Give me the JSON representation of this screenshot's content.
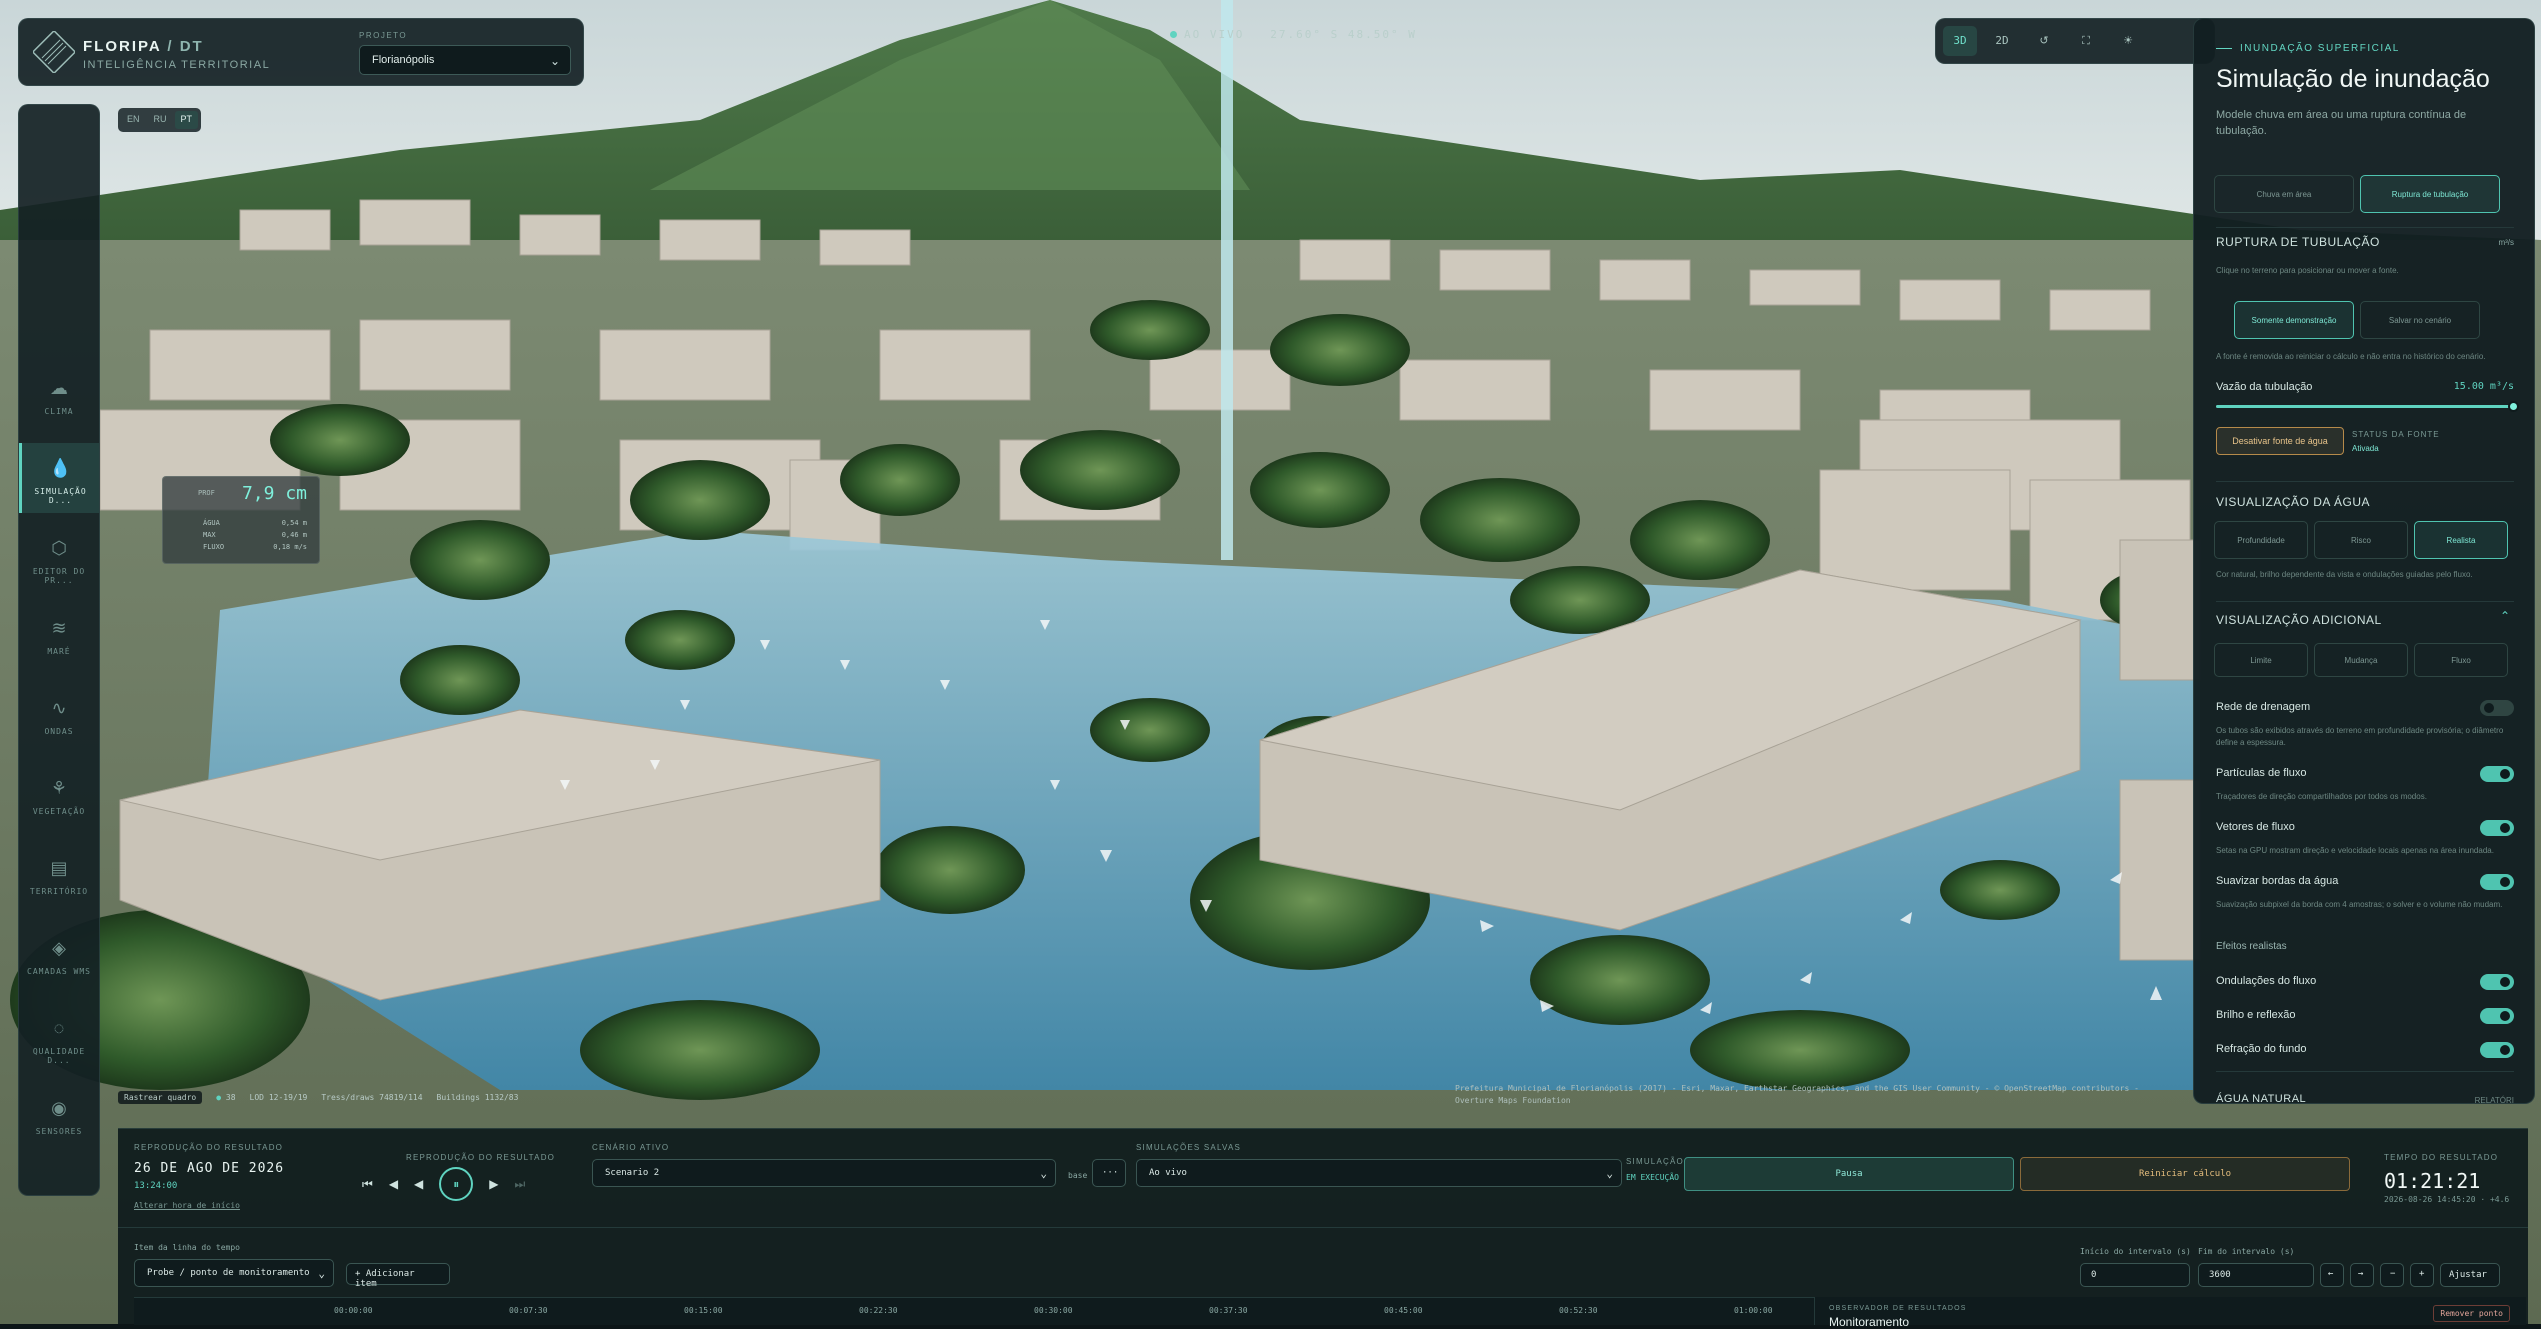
{
  "colors": {
    "accent": "#5fd3c0",
    "warning": "#e0b36a",
    "panel": "#14212a"
  },
  "header": {
    "brand": "FLORIPA",
    "brand_sep": "/",
    "brand_suffix": "DT",
    "subtitle": "INTELIGÊNCIA TERRITORIAL",
    "project_label": "PROJETO",
    "project_value": "Florianópolis"
  },
  "sidebar": {
    "items": [
      {
        "label": "CLIMA",
        "icon": "cloud-icon"
      },
      {
        "label": "SIMULAÇÃO D...",
        "icon": "water-drop-icon",
        "active": true
      },
      {
        "label": "EDITOR DO PR...",
        "icon": "cube-icon"
      },
      {
        "label": "MARÉ",
        "icon": "tide-icon"
      },
      {
        "label": "ONDAS",
        "icon": "wave-icon"
      },
      {
        "label": "VEGETAÇÃO",
        "icon": "plant-icon"
      },
      {
        "label": "TERRITÓRIO",
        "icon": "map-icon"
      },
      {
        "label": "CAMADAS WMS",
        "icon": "layers-icon"
      },
      {
        "label": "QUALIDADE D...",
        "icon": "droplet-quality-icon"
      },
      {
        "label": "SENSORES",
        "icon": "sensor-icon"
      }
    ]
  },
  "lang": [
    "EN",
    "RU",
    "PT"
  ],
  "live": {
    "text": "AO VIVO",
    "coords": "27.60° S 48.50° W"
  },
  "viewtools": {
    "btn_3d": "3D",
    "btn_2d": "2D"
  },
  "probe": {
    "tag": "PROF",
    "depth": "7,9 cm",
    "rows": [
      {
        "k": "ÁGUA",
        "v": "0,54 m"
      },
      {
        "k": "MAX",
        "v": "0,46 m"
      },
      {
        "k": "FLUXO",
        "v": "0,18 m/s"
      }
    ]
  },
  "statusbar": {
    "track": "Rastrear quadro",
    "fps": "38",
    "lod_label": "LOD",
    "lod": "12-19/19",
    "tris_label": "Tress/draws",
    "tris": "74819/114",
    "bld_label": "Buildings",
    "bld": "1132/83"
  },
  "attribution": "Prefeitura Municipal de Florianópolis (2017) - Esri, Maxar, Earthstar Geographics, and the GIS User Community - © OpenStreetMap contributors - Overture Maps Foundation",
  "panel": {
    "eyebrow": "INUNDAÇÃO SUPERFICIAL",
    "title": "Simulação de inundação",
    "desc": "Modele chuva em área ou uma ruptura contínua de tubulação.",
    "mode_a": "Chuva em área",
    "mode_b": "Ruptura de tubulação",
    "sec_rupture": "RUPTURA DE TUBULAÇÃO",
    "unit": "m³/s",
    "rupture_note": "Clique no terreno para posicionar ou mover a fonte.",
    "demo_btn": "Somente demonstração",
    "save_btn": "Salvar no cenário",
    "demo_note": "A fonte é removida ao reiniciar o cálculo e não entra no histórico do cenário.",
    "flow_label": "Vazão da tubulação",
    "flow_value": "15.00 m³/s",
    "flow_fraction": 1.0,
    "deactivate_btn": "Desativar fonte de água",
    "source_status_label": "STATUS DA FONTE",
    "source_status": "Ativada",
    "sec_water": "VISUALIZAÇÃO DA ÁGUA",
    "water_a": "Profundidade",
    "water_b": "Risco",
    "water_c": "Realista",
    "water_note": "Cor natural, brilho dependente da vista e ondulações guiadas pelo fluxo.",
    "sec_extra": "VISUALIZAÇÃO ADICIONAL",
    "extra_a": "Limite",
    "extra_b": "Mudança",
    "extra_c": "Fluxo",
    "drain_label": "Rede de drenagem",
    "drain_note": "Os tubos são exibidos através do terreno em profundidade provisória; o diâmetro define a espessura.",
    "particles_label": "Partículas de fluxo",
    "particles_note": "Traçadores de direção compartilhados por todos os modos.",
    "vectors_label": "Vetores de fluxo",
    "vectors_note": "Setas na GPU mostram direção e velocidade locais apenas na área inundada.",
    "smooth_label": "Suavizar bordas da água",
    "smooth_note": "Suavização subpixel da borda com 4 amostras; o solver e o volume não mudam.",
    "effects_label": "Efeitos realistas",
    "ripples_label": "Ondulações do fluxo",
    "glow_label": "Brilho e reflexão",
    "refraction_label": "Refração do fundo",
    "natural_water": "ÁGUA NATURAL",
    "natural_tail": "RELATÓRI"
  },
  "bottom": {
    "repro_label": "REPRODUÇÃO DO RESULTADO",
    "date": "26 DE AGO DE 2026",
    "time": "13:24:00",
    "change_start": "Alterar hora de início",
    "repro_label2": "REPRODUÇÃO DO RESULTADO",
    "scenario_label": "CENÁRIO ATIVO",
    "scenario_value": "Scenario 2",
    "base": "base",
    "more": "···",
    "saved_label": "SIMULAÇÕES SALVAS",
    "saved_value": "Ao vivo",
    "sim_label": "SIMULAÇÃO",
    "sim_status": "EM EXECUÇÃO",
    "pause_btn": "Pausa",
    "restart_btn": "Reiniciar cálculo",
    "result_time_label": "TEMPO DO RESULTADO",
    "result_time": "01:21:21",
    "result_stamp": "2026-08-26 14:45:20 · +4.6",
    "timeline_item_label": "Item da linha do tempo",
    "timeline_item_value": "Probe / ponto de monitoramento",
    "add_item": "+ Adicionar item",
    "interval_start_label": "Início do intervalo (s)",
    "interval_start": "0",
    "interval_end_label": "Fim do intervalo (s)",
    "interval_end": "3600",
    "adjust": "Ajustar",
    "ticks": [
      "00:00:00",
      "00:07:30",
      "00:15:00",
      "00:22:30",
      "00:30:00",
      "00:37:30",
      "00:45:00",
      "00:52:30",
      "01:00:00"
    ],
    "observer_label": "OBSERVADOR DE RESULTADOS",
    "observer_title": "Monitoramento",
    "remove_point": "Remover ponto"
  }
}
